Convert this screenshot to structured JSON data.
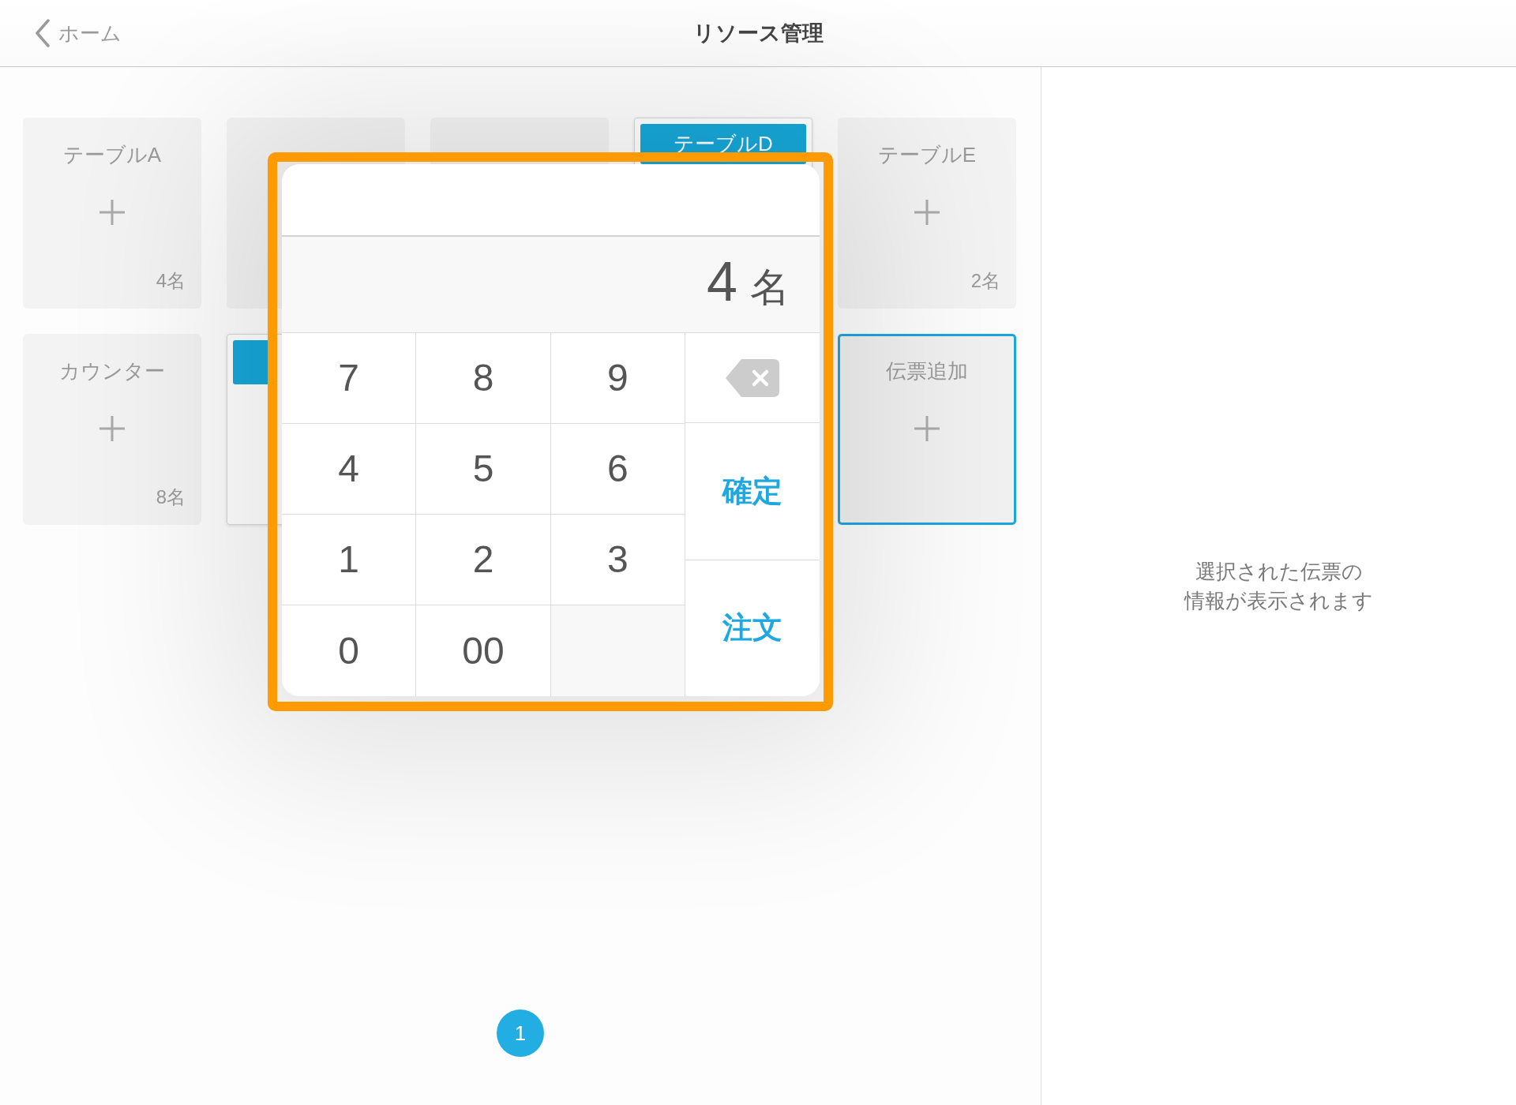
{
  "header": {
    "back_label": "ホーム",
    "title": "リソース管理"
  },
  "tables": [
    {
      "kind": "vacant",
      "label": "テーブルA",
      "seats": "4名"
    },
    {
      "kind": "vacant"
    },
    {
      "kind": "vacant"
    },
    {
      "kind": "occupied",
      "label": "テーブルD"
    },
    {
      "kind": "vacant",
      "label": "テーブルE",
      "seats": "2名"
    },
    {
      "kind": "vacant",
      "label": "カウンター",
      "seats": "8名"
    },
    {
      "kind": "ticket"
    },
    {
      "kind": "add",
      "label": "伝票追加"
    }
  ],
  "keypad": {
    "display": {
      "value": "4",
      "unit": "名"
    },
    "keys": [
      {
        "kind": "digit",
        "label": "7"
      },
      {
        "kind": "digit",
        "label": "8"
      },
      {
        "kind": "digit",
        "label": "9"
      },
      {
        "kind": "digit",
        "label": "4"
      },
      {
        "kind": "digit",
        "label": "5"
      },
      {
        "kind": "digit",
        "label": "6"
      },
      {
        "kind": "digit",
        "label": "1"
      },
      {
        "kind": "digit",
        "label": "2"
      },
      {
        "kind": "digit",
        "label": "3"
      },
      {
        "kind": "digit",
        "label": "0"
      },
      {
        "kind": "digit",
        "label": "00"
      },
      {
        "kind": "blank"
      }
    ],
    "side_keys": [
      {
        "kind": "backspace"
      },
      {
        "kind": "action",
        "label": "確定"
      },
      {
        "kind": "action",
        "label": "注文"
      }
    ]
  },
  "detail_panel": {
    "message_lines": [
      "選択された伝票の",
      "情報が表示されます"
    ]
  },
  "pagination": {
    "pages": [
      {
        "label": "1",
        "selected": true
      }
    ]
  }
}
